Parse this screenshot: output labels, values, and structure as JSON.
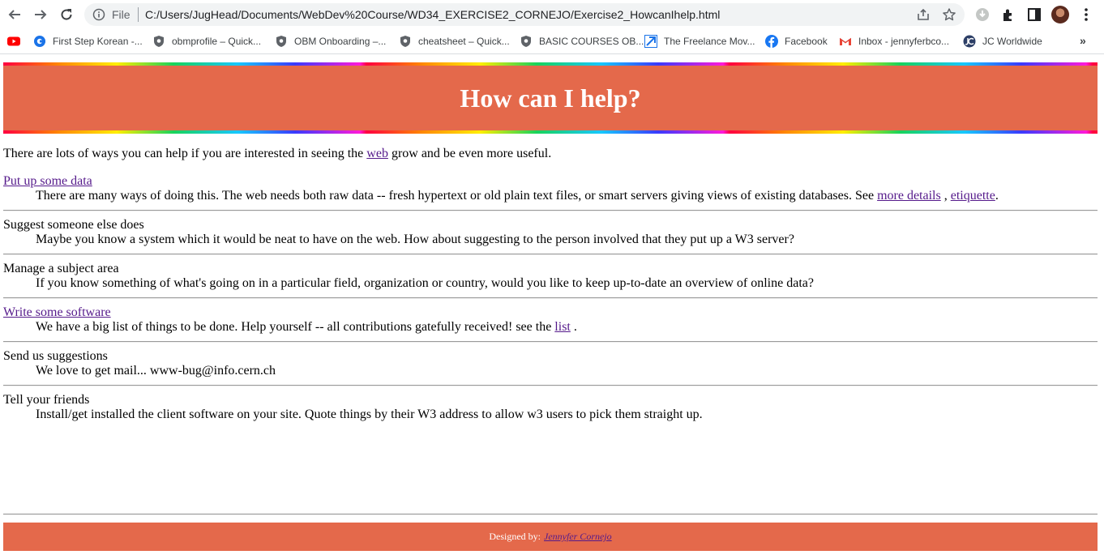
{
  "browser": {
    "omnibox": {
      "scheme_label": "File",
      "url": "C:/Users/JugHead/Documents/WebDev%20Course/WD34_EXERCISE2_CORNEJO/Exercise2_HowcanIhelp.html"
    },
    "bookmarks": [
      {
        "label": "",
        "icon": "youtube-icon"
      },
      {
        "label": "First Step Korean -...",
        "icon": "coursera-icon"
      },
      {
        "label": "obmprofile – Quick...",
        "icon": "shield-icon"
      },
      {
        "label": "OBM Onboarding –...",
        "icon": "shield-icon"
      },
      {
        "label": "cheatsheet – Quick...",
        "icon": "shield-icon"
      },
      {
        "label": "BASIC COURSES OB...",
        "icon": "shield-icon"
      },
      {
        "label": "The Freelance Mov...",
        "icon": "freelance-icon"
      },
      {
        "label": "Facebook",
        "icon": "facebook-icon"
      },
      {
        "label": "Inbox - jennyferbco...",
        "icon": "gmail-icon"
      },
      {
        "label": "JC Worldwide",
        "icon": "jc-icon"
      }
    ],
    "more_bookmarks": "»"
  },
  "page": {
    "title": "How can I help?",
    "intro": {
      "before": "There are lots of ways you can help if you are interested in seeing the ",
      "link": "web",
      "after": " grow and be even more useful."
    },
    "entries": [
      {
        "term": "Put up some data",
        "desc_before": "There are many ways of doing this. The web needs both raw data -- fresh hypertext or old plain text files, or smart servers giving views of existing databases. See ",
        "link1": "more details",
        "sep": " , ",
        "link2": "etiquette",
        "desc_after": "."
      },
      {
        "term": "Suggest someone else does",
        "desc": "Maybe you know a system which it would be neat to have on the web. How about suggesting to the person involved that they put up a W3 server?"
      },
      {
        "term": "Manage a subject area",
        "desc": "If you know something of what's going on in a particular field, organization or country, would you like to keep up-to-date an overview of online data?"
      },
      {
        "term": "Write some software",
        "desc_before": "We have a big list of things to be done. Help yourself -- all contributions gatefully received! see the ",
        "link": "list",
        "desc_after": " ."
      },
      {
        "term": "Send us suggestions",
        "desc": "We love to get mail... www-bug@info.cern.ch"
      },
      {
        "term": "Tell your friends",
        "desc": "Install/get installed the client software on your site. Quote things by their W3 address to allow w3 users to pick them straight up."
      }
    ],
    "footer": {
      "label": "Designed by:",
      "author": "Jennyfer Cornejo"
    }
  },
  "colors": {
    "banner": "#e4694b",
    "link_visited": "#551a8b",
    "banner_text": "#ffffff"
  }
}
